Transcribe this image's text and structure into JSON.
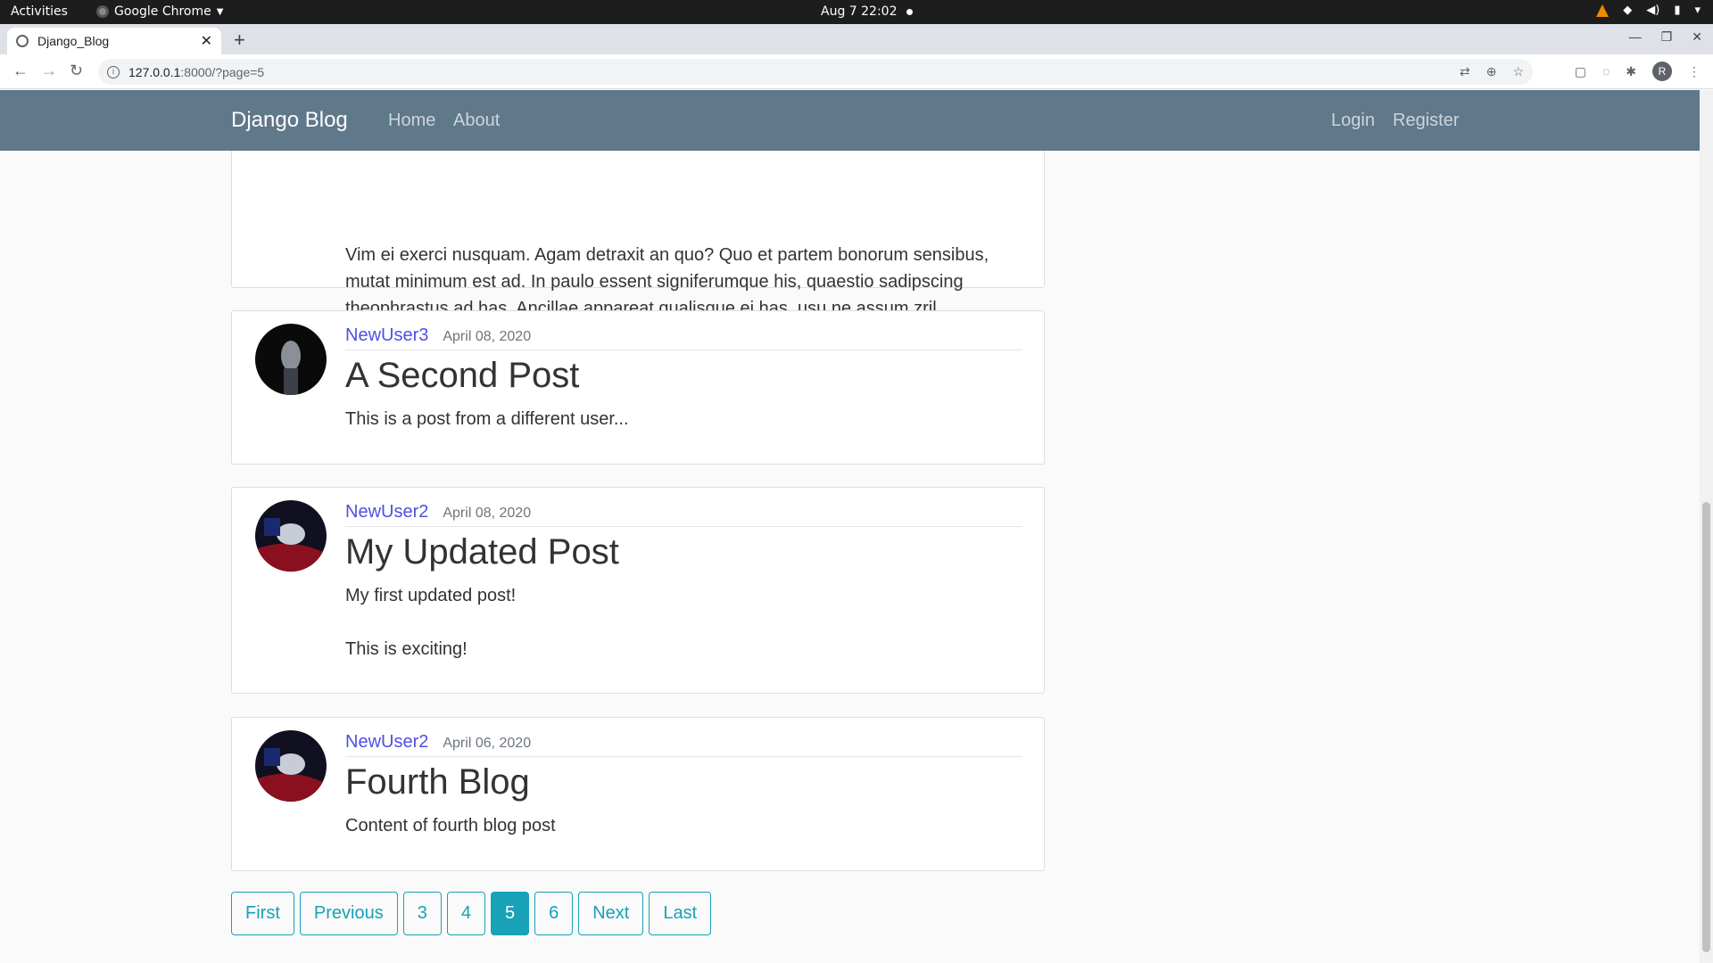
{
  "system_bar": {
    "activities": "Activities",
    "app_name": "Google Chrome",
    "clock": "Aug 7  22:02"
  },
  "browser": {
    "tab_title": "Django_Blog",
    "url_host": "127.0.0.1",
    "url_path": ":8000/?page=5",
    "profile_initial": "R"
  },
  "site": {
    "brand": "Django Blog",
    "nav_left": [
      "Home",
      "About"
    ],
    "nav_right": [
      "Login",
      "Register"
    ]
  },
  "posts": [
    {
      "body": "Vim ei exerci nusquam. Agam detraxit an quo? Quo et partem bonorum sensibus, mutat minimum est ad. In paulo essent signiferumque his, quaestio sadipscing theophrastus ad has. Ancillae appareat qualisque ei has, usu ne assum zril disputationi, sed at gloriatur persequeris."
    },
    {
      "author": "NewUser3",
      "date": "April 08, 2020",
      "title": "A Second Post",
      "body": "This is a post from a different user..."
    },
    {
      "author": "NewUser2",
      "date": "April 08, 2020",
      "title": "My Updated Post",
      "body": "My first updated post!\n\nThis is exciting!"
    },
    {
      "author": "NewUser2",
      "date": "April 06, 2020",
      "title": "Fourth Blog",
      "body": "Content of fourth blog post"
    }
  ],
  "pagination": {
    "first": "First",
    "previous": "Previous",
    "pages": [
      "3",
      "4",
      "5",
      "6"
    ],
    "current_page": "5",
    "next": "Next",
    "last": "Last"
  }
}
